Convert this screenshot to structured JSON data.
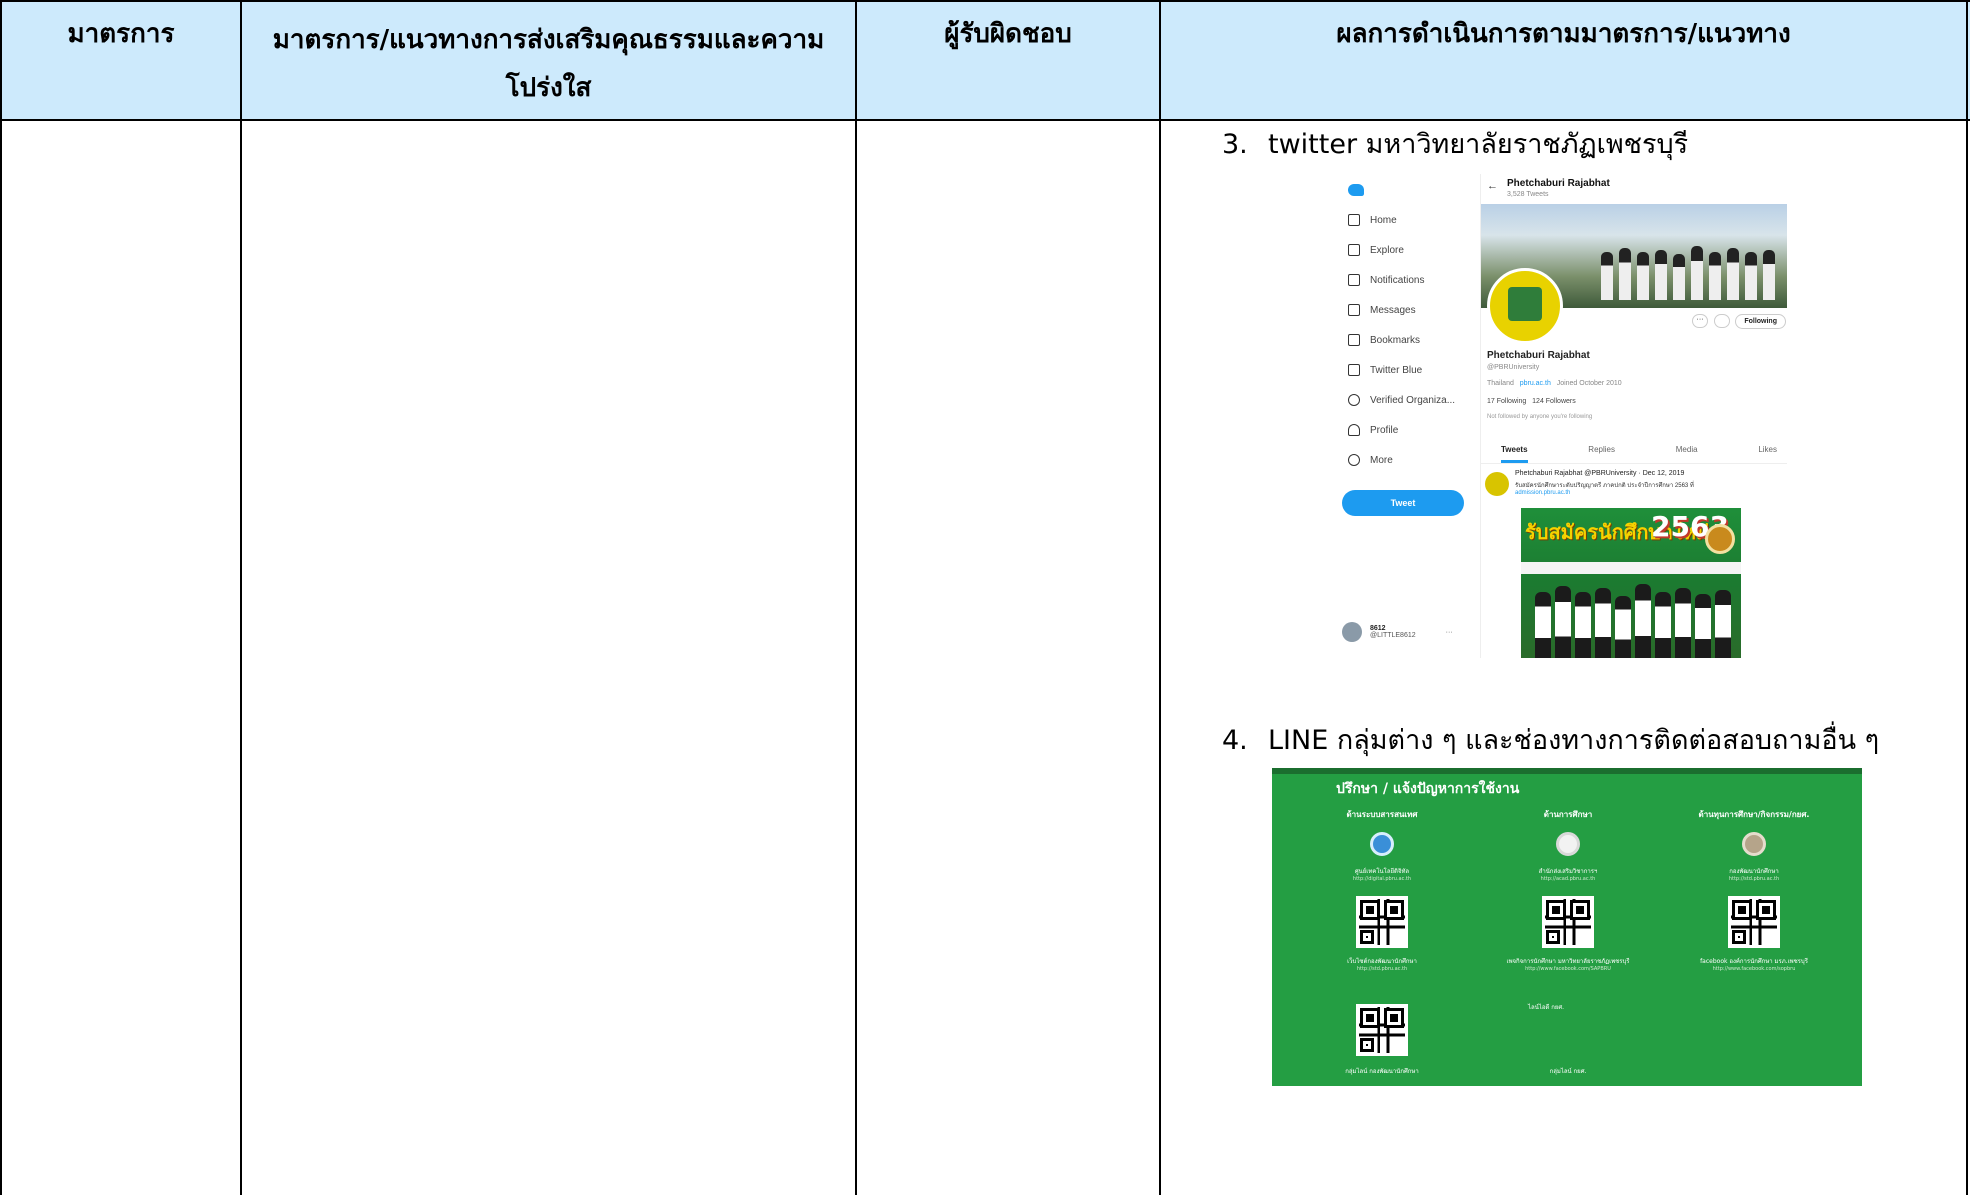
{
  "table": {
    "headers": [
      "มาตรการ",
      "มาตรการ/แนวทางการส่งเสริมคุณธรรมและความโปร่งใส",
      "ผู้รับผิดชอบ",
      "ผลการดำเนินการตามมาตรการ/แนวทาง"
    ],
    "header_2_line1": "มาตรการ/แนวทางการส่งเสริมคุณธรรมและความ",
    "header_2_line2": "โปร่งใส"
  },
  "results": {
    "item3": {
      "number": "3.",
      "text": "twitter มหาวิทยาลัยราชภัฏเพชรบุรี"
    },
    "item4": {
      "number": "4.",
      "text": "LINE กลุ่มต่าง ๆ และช่องทางการติดต่อสอบถามอื่น ๆ"
    }
  },
  "twitter_screenshot": {
    "back_arrow": "←",
    "profile_title": "Phetchaburi Rajabhat",
    "tweet_count": "3,528 Tweets",
    "nav": [
      "Home",
      "Explore",
      "Notifications",
      "Messages",
      "Bookmarks",
      "Twitter Blue",
      "Verified Organiza...",
      "Profile",
      "More"
    ],
    "nav_icons": [
      "home-icon",
      "hashtag-icon",
      "bell-icon",
      "envelope-icon",
      "bookmark-icon",
      "twitter-blue-icon",
      "verified-icon",
      "profile-icon",
      "more-icon"
    ],
    "tweet_button": "Tweet",
    "user_name": "8612",
    "user_handle": "@LITTLE8612",
    "user_more": "···",
    "following_button": "Following",
    "more_button": "···",
    "name": "Phetchaburi Rajabhat",
    "handle": "@PBRUniversity",
    "location": "Thailand",
    "website": "pbru.ac.th",
    "joined": "Joined October 2010",
    "following_count": "17 Following",
    "followers_count": "124 Followers",
    "not_followed": "Not followed by anyone you're following",
    "tabs": [
      "Tweets",
      "Replies",
      "Media",
      "Likes"
    ],
    "post_header": "Phetchaburi Rajabhat @PBRUniversity · Dec 12, 2019",
    "post_body": "รับสมัครนักศึกษาระดับปริญญาตรี ภาคปกติ ประจำปีการศึกษา 2563 ที่",
    "post_link": "admission.pbru.ac.th",
    "poster_title": "รับสมัครนักศึกษาใหม่",
    "poster_year": "2563",
    "accent_color": "#1d9bf0"
  },
  "line_panel": {
    "title": "ปรึกษา / แจ้งปัญหาการใช้งาน",
    "background_color": "#249e43",
    "columns": [
      {
        "heading": "ด้านระบบสารสนเทศ",
        "caption": "ศูนย์เทคโนโลยีดิจิทัล",
        "url": "http://digital.pbru.ac.th",
        "qr_label": "เว็บไซต์กองพัฒนานักศึกษา",
        "qr_url": "http://std.pbru.ac.th"
      },
      {
        "heading": "ด้านการศึกษา",
        "caption": "สำนักส่งเสริมวิชาการฯ",
        "url": "http://acad.pbru.ac.th",
        "qr_label": "เพจกิจการนักศึกษา มหาวิทยาลัยราชภัฏเพชรบุรี",
        "qr_url": "http://www.facebook.com/SAPBRU"
      },
      {
        "heading": "ด้านทุนการศึกษา/กิจกรรม/กยศ.",
        "caption": "กองพัฒนานักศึกษา",
        "url": "http://std.pbru.ac.th",
        "qr_label": "facebook องค์การนักศึกษา มรภ.เพชรบุรี",
        "qr_url": "http://www.facebook.com/sopbru"
      }
    ],
    "line_official": "ไลน์ไอดี กยศ.",
    "bottom_left": "กลุ่มไลน์ กองพัฒนานักศึกษา",
    "bottom_mid": "กลุ่มไลน์ กยศ."
  }
}
